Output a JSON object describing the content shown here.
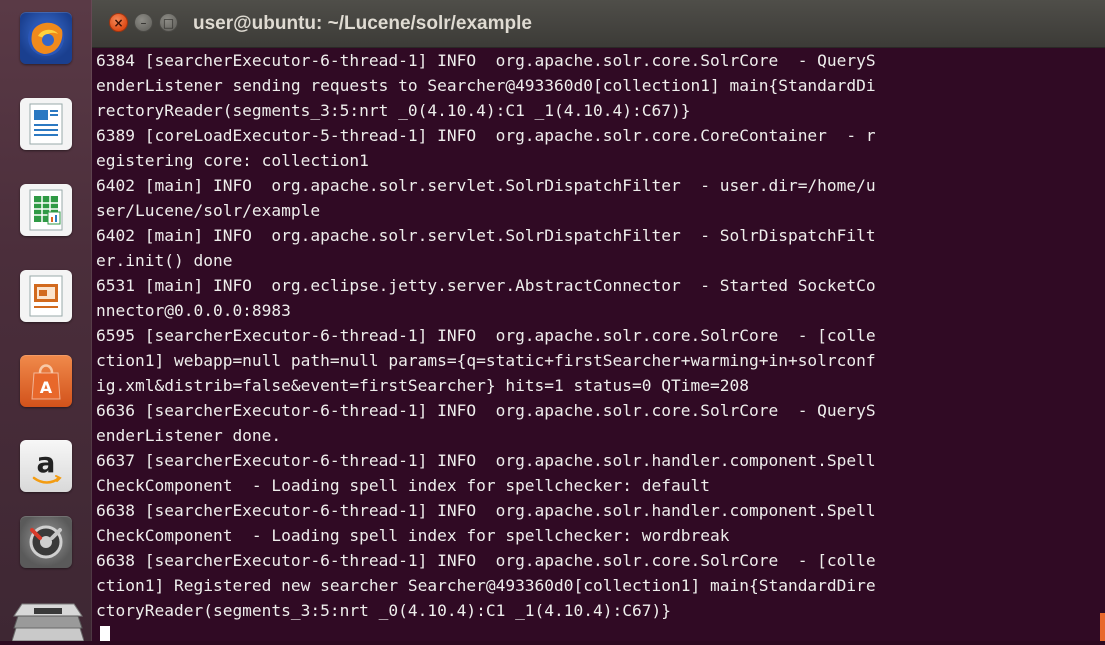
{
  "launcher": {
    "items": [
      {
        "name": "firefox-icon",
        "color": "#e66000"
      },
      {
        "name": "libreoffice-writer-icon",
        "color": "#1d6fb8"
      },
      {
        "name": "libreoffice-calc-icon",
        "color": "#1b8a3a"
      },
      {
        "name": "libreoffice-impress-icon",
        "color": "#d2691e"
      },
      {
        "name": "ubuntu-software-center-icon",
        "color": "#e0651f"
      },
      {
        "name": "amazon-icon",
        "color": "#e8e8e8"
      },
      {
        "name": "system-settings-icon",
        "color": "#6a6a6a"
      },
      {
        "name": "workspace-switcher-icon",
        "color": "#b0b0b0"
      }
    ]
  },
  "window": {
    "title": "user@ubuntu: ~/Lucene/solr/example",
    "close_glyph": "×",
    "minimize_glyph": "–",
    "maximize_glyph": "□"
  },
  "colors": {
    "terminal_bg": "#300a24",
    "terminal_fg": "#eeeeec",
    "close_button": "#df4b16",
    "scroll_marker": "#e8682b"
  },
  "terminal": {
    "lines": [
      "6384 [searcherExecutor-6-thread-1] INFO  org.apache.solr.core.SolrCore  - QueryS",
      "enderListener sending requests to Searcher@493360d0[collection1] main{StandardDi",
      "rectoryReader(segments_3:5:nrt _0(4.10.4):C1 _1(4.10.4):C67)}",
      "6389 [coreLoadExecutor-5-thread-1] INFO  org.apache.solr.core.CoreContainer  - r",
      "egistering core: collection1",
      "6402 [main] INFO  org.apache.solr.servlet.SolrDispatchFilter  - user.dir=/home/u",
      "ser/Lucene/solr/example",
      "6402 [main] INFO  org.apache.solr.servlet.SolrDispatchFilter  - SolrDispatchFilt",
      "er.init() done",
      "6531 [main] INFO  org.eclipse.jetty.server.AbstractConnector  - Started SocketCo",
      "nnector@0.0.0.0:8983",
      "6595 [searcherExecutor-6-thread-1] INFO  org.apache.solr.core.SolrCore  - [colle",
      "ction1] webapp=null path=null params={q=static+firstSearcher+warming+in+solrconf",
      "ig.xml&distrib=false&event=firstSearcher} hits=1 status=0 QTime=208",
      "6636 [searcherExecutor-6-thread-1] INFO  org.apache.solr.core.SolrCore  - QueryS",
      "enderListener done.",
      "6637 [searcherExecutor-6-thread-1] INFO  org.apache.solr.handler.component.Spell",
      "CheckComponent  - Loading spell index for spellchecker: default",
      "6638 [searcherExecutor-6-thread-1] INFO  org.apache.solr.handler.component.Spell",
      "CheckComponent  - Loading spell index for spellchecker: wordbreak",
      "6638 [searcherExecutor-6-thread-1] INFO  org.apache.solr.core.SolrCore  - [colle",
      "ction1] Registered new searcher Searcher@493360d0[collection1] main{StandardDire",
      "ctoryReader(segments_3:5:nrt _0(4.10.4):C1 _1(4.10.4):C67)}"
    ]
  }
}
